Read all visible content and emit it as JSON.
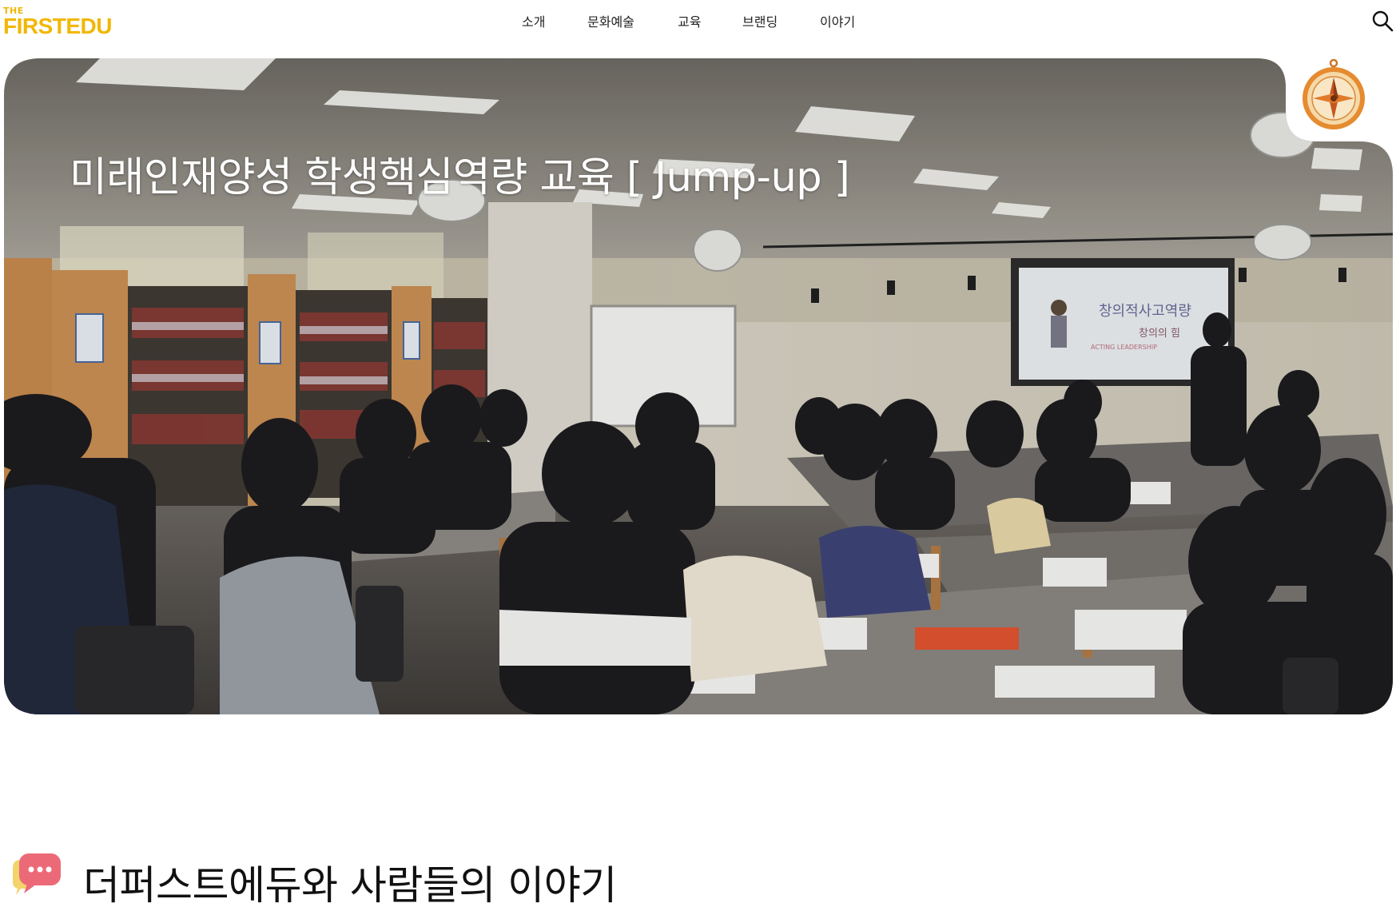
{
  "brand": {
    "logo_small": "THE",
    "logo_main": "FIRSTEDU",
    "color": "#f2b705"
  },
  "nav": {
    "items": [
      {
        "label": "소개"
      },
      {
        "label": "문화예술"
      },
      {
        "label": "교육"
      },
      {
        "label": "브랜딩"
      },
      {
        "label": "이야기"
      }
    ],
    "search_icon": "search-icon"
  },
  "hero": {
    "title": "미래인재양성 학생핵심역량 교육 [ Jump-up ]",
    "screen_slide": {
      "title": "창의적사고역량",
      "subtitle": "창의의 힘",
      "caption": "ACTING LEADERSHIP"
    },
    "badge_icon": "compass-icon"
  },
  "section": {
    "icon": "chat-bubble-icon",
    "title": "더퍼스트에듀와 사람들의 이야기"
  }
}
